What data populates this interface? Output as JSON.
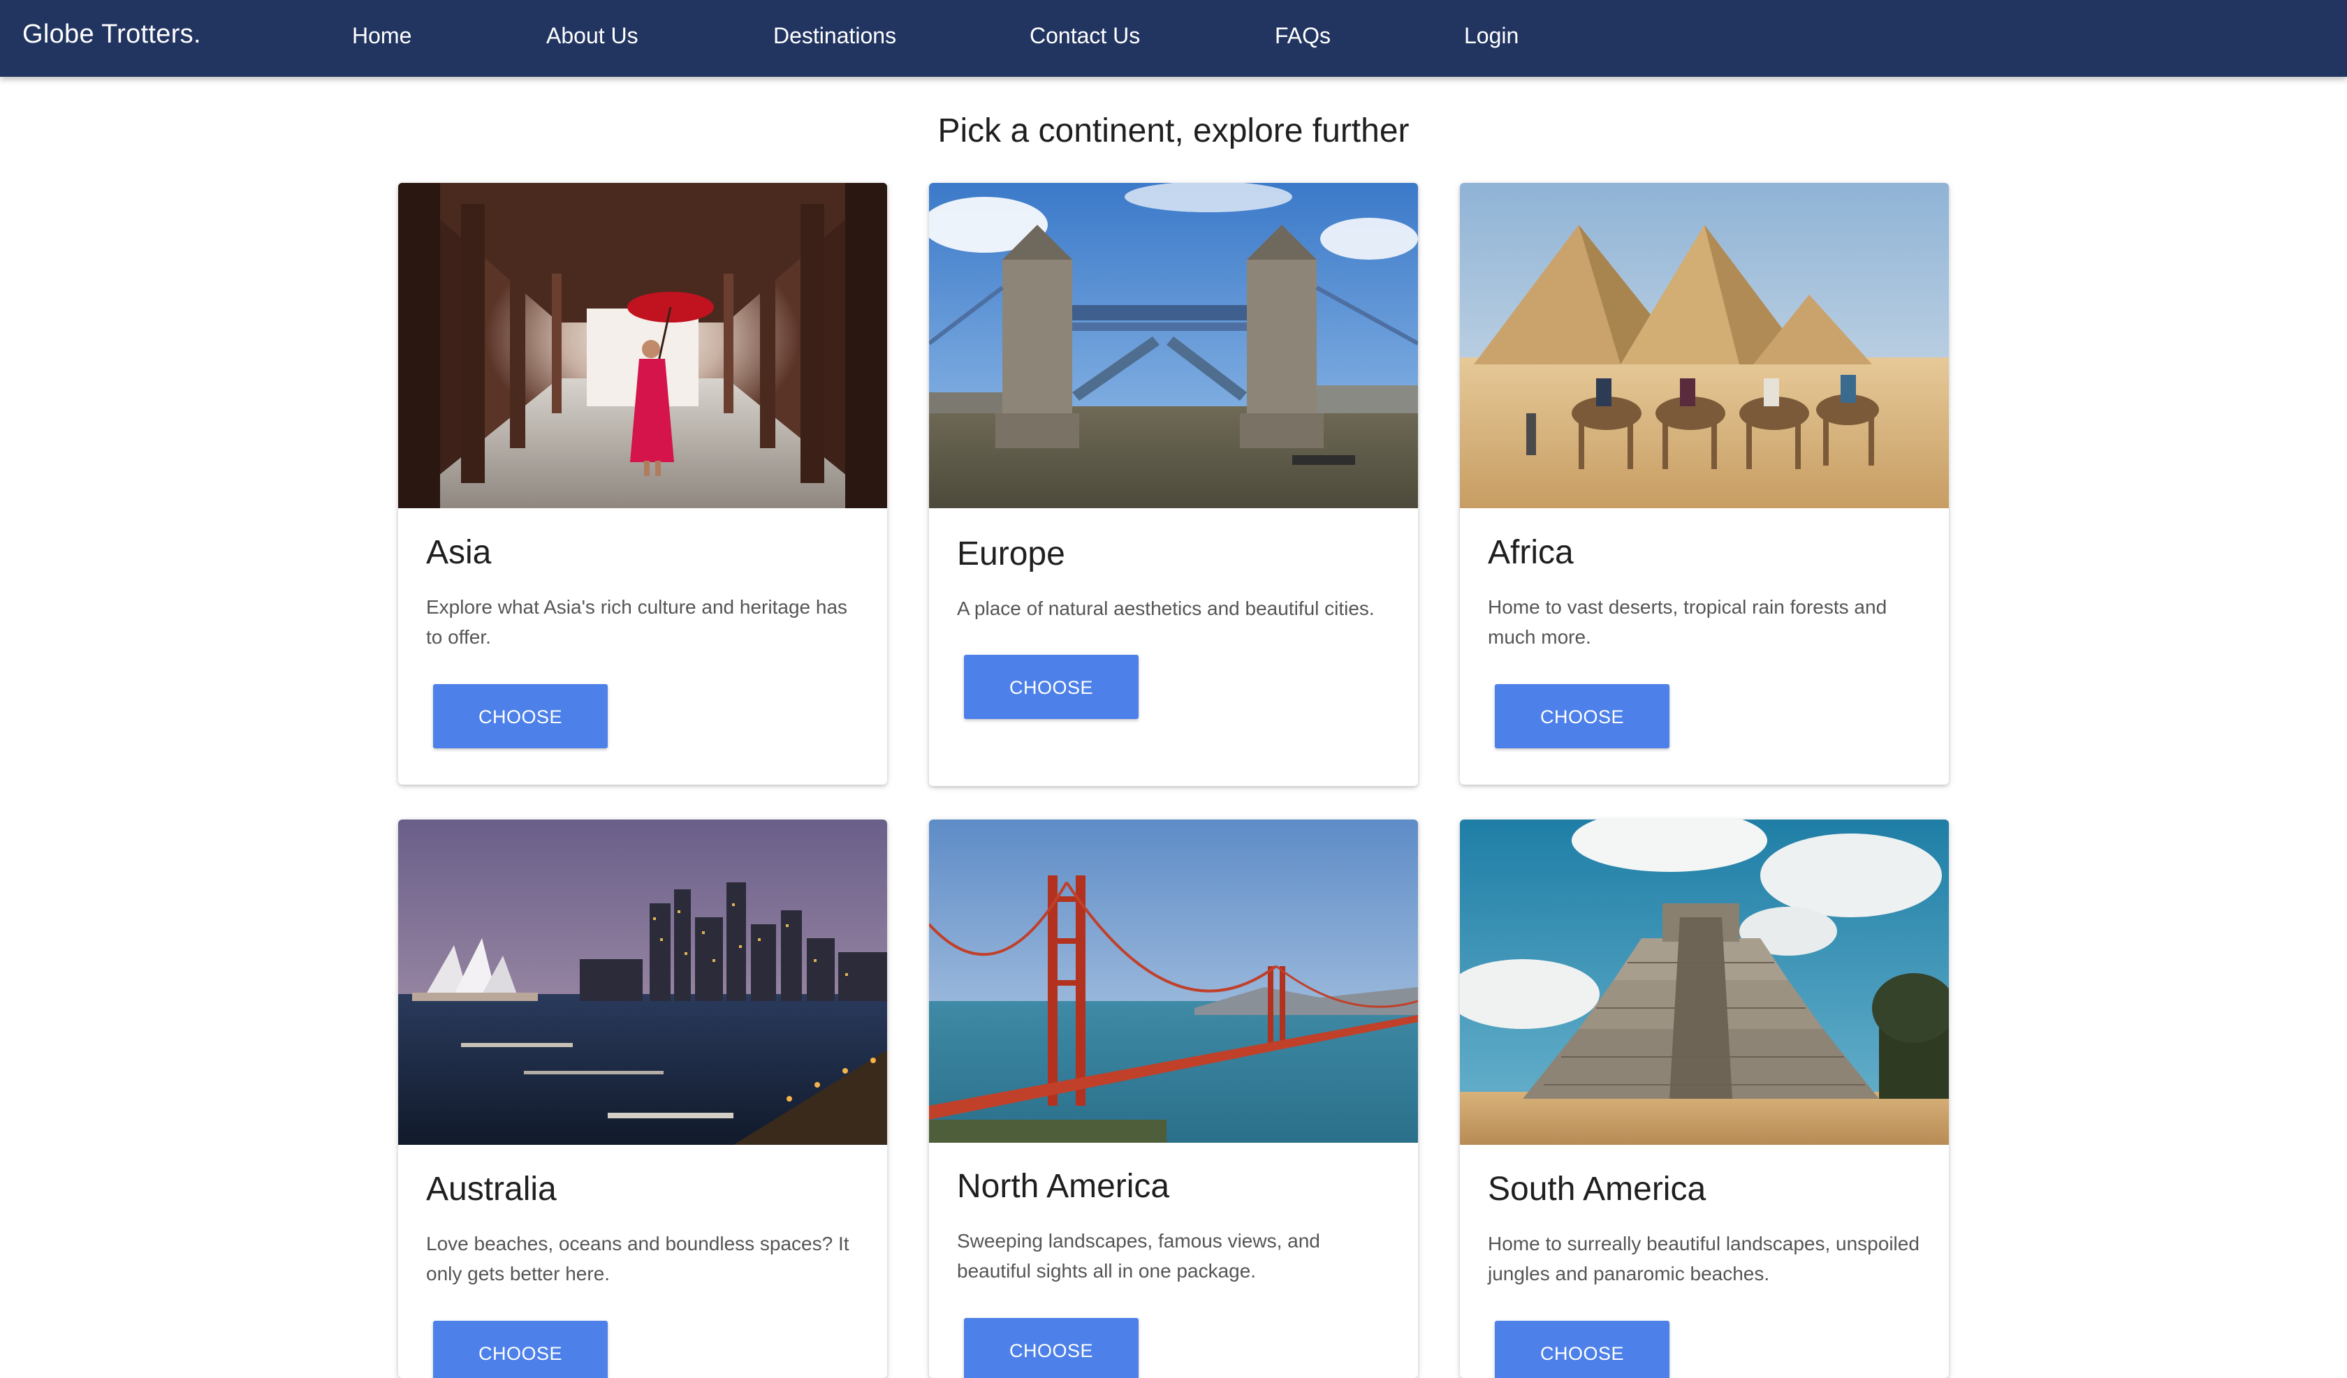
{
  "nav": {
    "brand": "Globe Trotters.",
    "links": [
      "Home",
      "About Us",
      "Destinations",
      "Contact Us",
      "FAQs",
      "Login"
    ]
  },
  "heading": "Pick a continent, explore further",
  "button_label": "CHOOSE",
  "colors": {
    "navbar": "#223561",
    "button": "#4d80e8",
    "title_text": "#1f1f1f",
    "body_text": "#555555"
  },
  "cards": [
    {
      "title": "Asia",
      "description": "Explore what Asia's rich culture and heritage has to offer.",
      "image": "monk-with-red-umbrella-photo"
    },
    {
      "title": "Europe",
      "description": "A place of natural aesthetics and beautiful cities.",
      "image": "tower-bridge-london-photo"
    },
    {
      "title": "Africa",
      "description": "Home to vast deserts, tropical rain forests and much more.",
      "image": "pyramids-and-camels-photo"
    },
    {
      "title": "Australia",
      "description": "Love beaches, oceans and boundless spaces? It only gets better here.",
      "image": "sydney-harbour-night-photo"
    },
    {
      "title": "North America",
      "description": "Sweeping landscapes, famous views, and beautiful sights all in one package.",
      "image": "golden-gate-bridge-photo"
    },
    {
      "title": "South America",
      "description": "Home to surreally beautiful landscapes, unspoiled jungles and panaromic beaches.",
      "image": "mayan-pyramid-photo"
    }
  ]
}
